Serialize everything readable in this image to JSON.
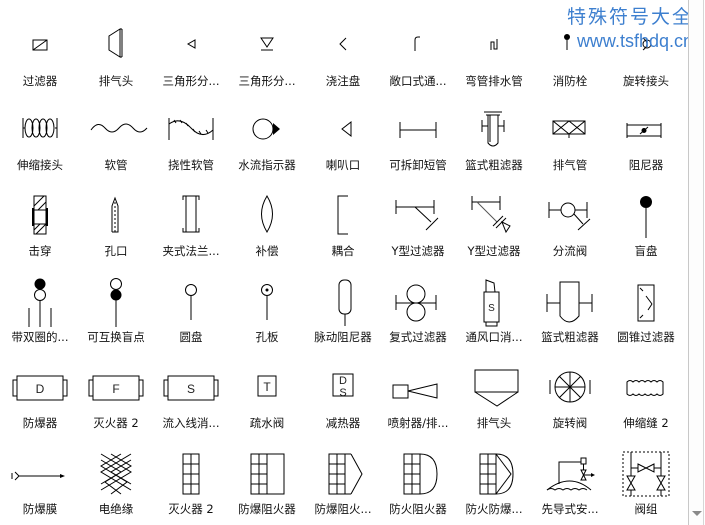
{
  "watermark": {
    "title": "特殊符号大全",
    "url": "www.tsfhdq.cn"
  },
  "shapes": [
    {
      "label": "过滤器",
      "icon": "filter-icon"
    },
    {
      "label": "排气头",
      "icon": "exhaust-head-icon"
    },
    {
      "label": "三角形分...",
      "icon": "triangle-left-icon"
    },
    {
      "label": "三角形分...",
      "icon": "triangle-down-icon"
    },
    {
      "label": "浇注盘",
      "icon": "chevron-left-icon"
    },
    {
      "label": "敞口式通...",
      "icon": "open-vent-icon"
    },
    {
      "label": "弯管排水管",
      "icon": "bent-drain-icon"
    },
    {
      "label": "消防栓",
      "icon": "hydrant-icon"
    },
    {
      "label": "旋转接头",
      "icon": "rotary-joint-icon"
    },
    {
      "label": "伸缩接头",
      "icon": "expansion-joint-icon"
    },
    {
      "label": "软管",
      "icon": "hose-icon"
    },
    {
      "label": "挠性软管",
      "icon": "flexible-hose-icon"
    },
    {
      "label": "水流指示器",
      "icon": "flow-indicator-icon"
    },
    {
      "label": "喇叭口",
      "icon": "bell-mouth-icon"
    },
    {
      "label": "可拆卸短管",
      "icon": "removable-spool-icon"
    },
    {
      "label": "篮式粗滤器",
      "icon": "basket-strainer-icon"
    },
    {
      "label": "排气管",
      "icon": "exhaust-pipe-icon"
    },
    {
      "label": "阻尼器",
      "icon": "damper-icon"
    },
    {
      "label": "击穿",
      "icon": "breakthrough-icon"
    },
    {
      "label": "孔口",
      "icon": "orifice-icon"
    },
    {
      "label": "夹式法兰...",
      "icon": "clamp-flange-icon"
    },
    {
      "label": "补偿",
      "icon": "compensator-icon"
    },
    {
      "label": "耦合",
      "icon": "coupling-icon"
    },
    {
      "label": "Y型过滤器",
      "icon": "y-strainer-icon"
    },
    {
      "label": "Y型过滤器",
      "icon": "y-strainer-valve-icon"
    },
    {
      "label": "分流阀",
      "icon": "diverter-valve-icon"
    },
    {
      "label": "盲盘",
      "icon": "blind-disc-icon"
    },
    {
      "label": "带双圈的...",
      "icon": "double-ring-icon"
    },
    {
      "label": "可互换盲点",
      "icon": "interchangeable-blind-icon"
    },
    {
      "label": "圆盘",
      "icon": "disc-icon"
    },
    {
      "label": "孔板",
      "icon": "orifice-plate-icon"
    },
    {
      "label": "脉动阻尼器",
      "icon": "pulsation-damper-icon"
    },
    {
      "label": "复式过滤器",
      "icon": "duplex-filter-icon"
    },
    {
      "label": "通风口消...",
      "icon": "vent-silencer-icon"
    },
    {
      "label": "篮式粗滤器",
      "icon": "basket-strainer-2-icon"
    },
    {
      "label": "圆锥过滤器",
      "icon": "cone-filter-icon"
    },
    {
      "label": "防爆器",
      "icon": "explosion-proof-icon",
      "letter": "D"
    },
    {
      "label": "灭火器 2",
      "icon": "fire-extinguisher-box-icon",
      "letter": "F"
    },
    {
      "label": "流入线消...",
      "icon": "inline-silencer-icon",
      "letter": "S"
    },
    {
      "label": "疏水阀",
      "icon": "steam-trap-icon",
      "letter": "T"
    },
    {
      "label": "减热器",
      "icon": "desuperheater-icon",
      "letter": "D",
      "letter2": "S"
    },
    {
      "label": "喷射器/排...",
      "icon": "ejector-icon"
    },
    {
      "label": "排气头",
      "icon": "exhaust-hood-icon"
    },
    {
      "label": "旋转阀",
      "icon": "rotary-valve-icon"
    },
    {
      "label": "伸缩缝 2",
      "icon": "expansion-seam-icon"
    },
    {
      "label": "防爆膜",
      "icon": "rupture-disc-icon"
    },
    {
      "label": "电绝缘",
      "icon": "insulation-icon"
    },
    {
      "label": "灭火器 2",
      "icon": "flame-arrester-grid-icon"
    },
    {
      "label": "防爆阻火器",
      "icon": "explosion-flame-arrester-icon"
    },
    {
      "label": "防爆阻火...",
      "icon": "explosion-flame-arrester-2-icon"
    },
    {
      "label": "防火阻火器",
      "icon": "fire-flame-arrester-icon"
    },
    {
      "label": "防火防爆...",
      "icon": "fire-explosion-arrester-icon"
    },
    {
      "label": "先导式安...",
      "icon": "pilot-safety-valve-icon"
    },
    {
      "label": "阀组",
      "icon": "valve-manifold-icon"
    }
  ]
}
